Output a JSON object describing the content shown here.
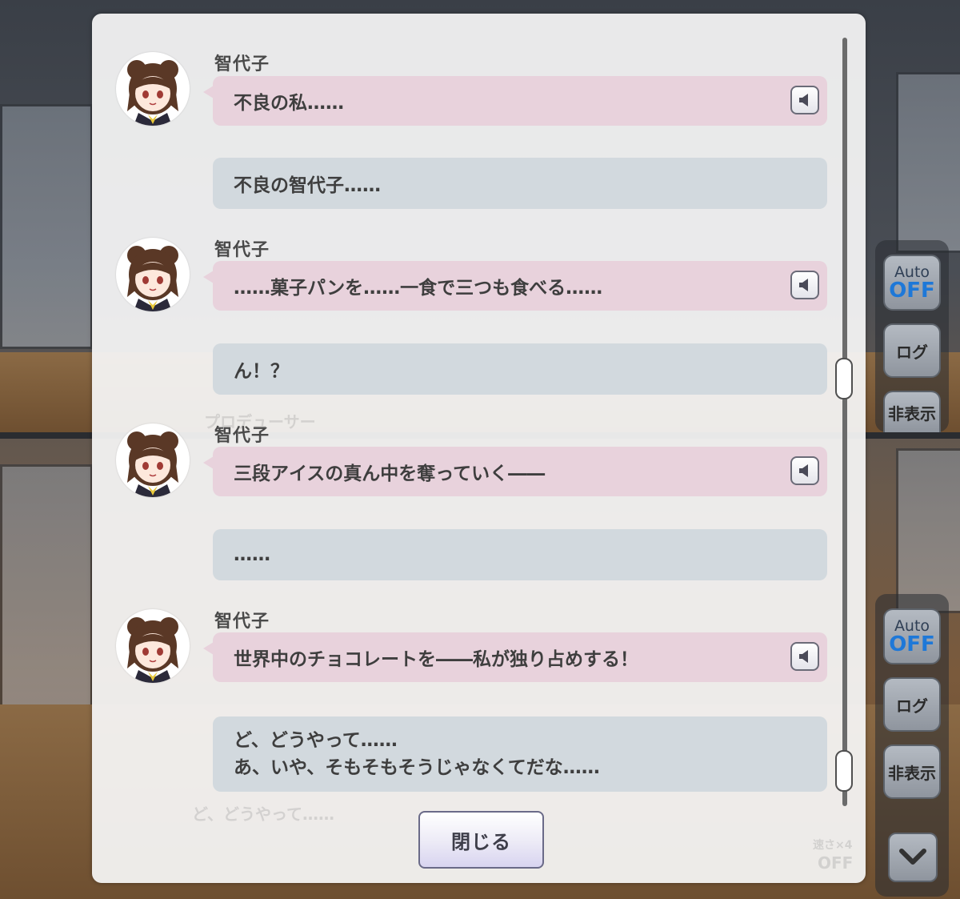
{
  "log": {
    "entries": [
      {
        "type": "npc",
        "speaker": "智代子",
        "text": "不良の私……"
      },
      {
        "type": "player",
        "text": "不良の智代子……"
      },
      {
        "type": "npc",
        "speaker": "智代子",
        "text": "……菓子パンを……一食で三つも食べる……"
      },
      {
        "type": "player",
        "text": "ん！？"
      },
      {
        "type": "npc",
        "speaker": "智代子",
        "text": "三段アイスの真ん中を奪っていく――"
      },
      {
        "type": "player",
        "text": "……"
      },
      {
        "type": "npc",
        "speaker": "智代子",
        "text": "世界中のチョコレートを――私が独り占めする！"
      },
      {
        "type": "player",
        "line1": "ど、どうやって……",
        "line2": "あ、いや、そもそもそうじゃなくてだな……"
      }
    ],
    "close_label": "閉じる"
  },
  "side_menu": {
    "auto_label": "Auto",
    "auto_state": "OFF",
    "log_label": "ログ",
    "hide_label": "非表示"
  },
  "background": {
    "faint_speaker": "プロデューサー",
    "faint_line": "ど、どうやって……",
    "faint_speed": "速さ×4",
    "faint_off": "OFF"
  },
  "icons": {
    "voice": "speaker-icon",
    "down": "chevron-down-icon"
  },
  "colors": {
    "npc_bubble": "#e8d2dc",
    "player_bubble": "#d2d9de",
    "auto_off": "#1e78d8"
  }
}
